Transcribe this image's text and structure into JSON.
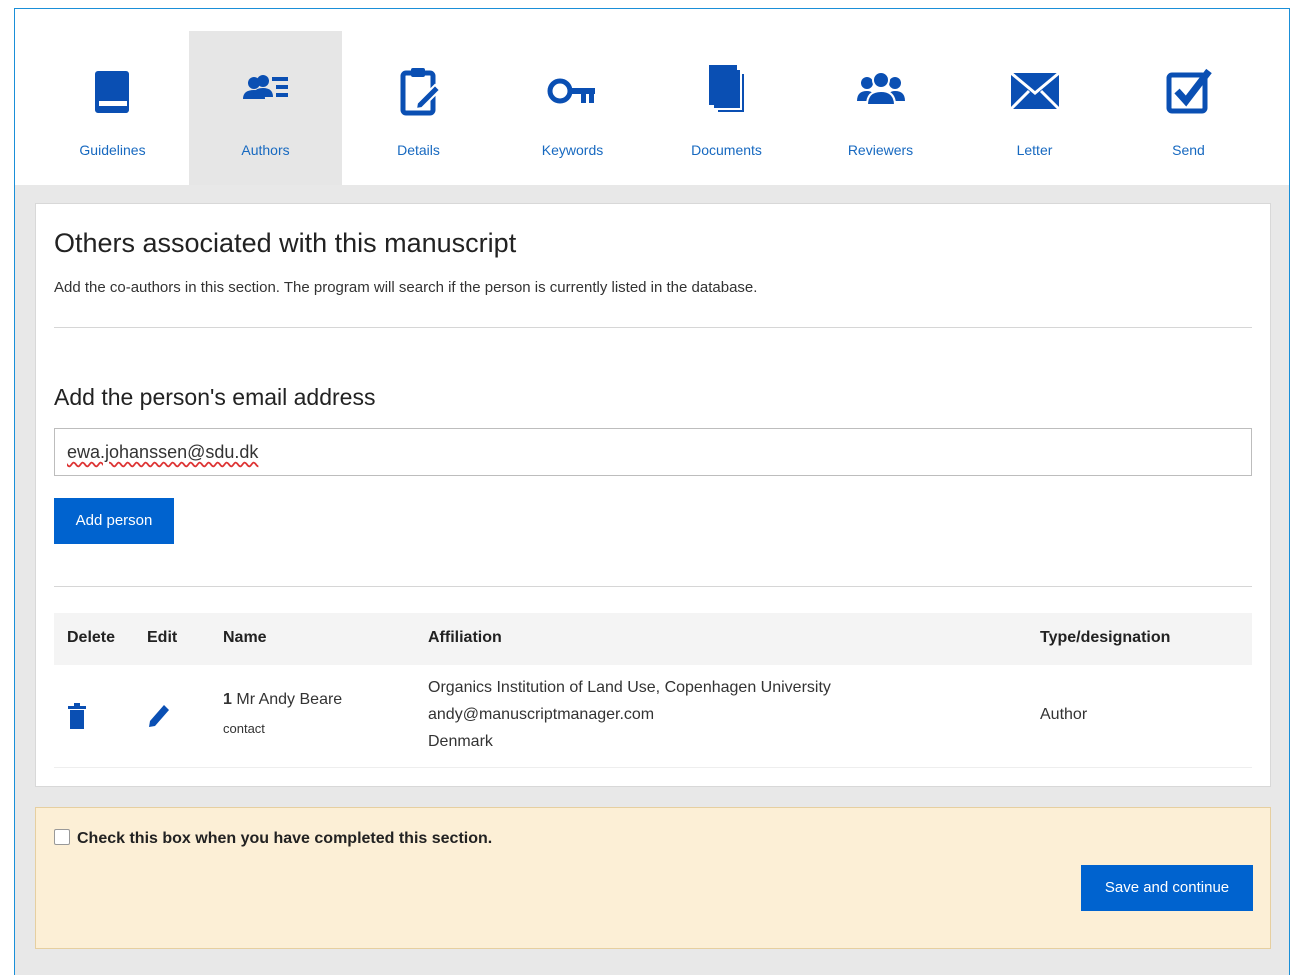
{
  "colors": {
    "accent": "#0063cf",
    "tab_label": "#1769c0",
    "footer_bg": "#fcefd6"
  },
  "tabs": [
    {
      "label": "Guidelines",
      "icon": "book-icon"
    },
    {
      "label": "Authors",
      "icon": "user-list-icon",
      "active": true
    },
    {
      "label": "Details",
      "icon": "clipboard-edit-icon"
    },
    {
      "label": "Keywords",
      "icon": "key-icon"
    },
    {
      "label": "Documents",
      "icon": "documents-icon"
    },
    {
      "label": "Reviewers",
      "icon": "users-icon"
    },
    {
      "label": "Letter",
      "icon": "envelope-icon"
    },
    {
      "label": "Send",
      "icon": "checkbox-icon"
    }
  ],
  "section": {
    "title": "Others associated with this manuscript",
    "description": "Add the co-authors in this section. The program will search if the person is currently listed in the database."
  },
  "email": {
    "label": "Add the person's email address",
    "value": "ewa.johanssen@sdu.dk",
    "add_button": "Add person"
  },
  "table": {
    "headers": {
      "delete": "Delete",
      "edit": "Edit",
      "name": "Name",
      "affiliation": "Affiliation",
      "type": "Type/designation"
    },
    "rows": [
      {
        "index": "1",
        "name": "Mr Andy Beare",
        "role": "contact",
        "affiliation_org": "Organics Institution of Land Use, Copenhagen University",
        "affiliation_email": "andy@manuscriptmanager.com",
        "affiliation_country": "Denmark",
        "type": "Author"
      }
    ]
  },
  "footer": {
    "checkbox_label": "Check this box when you have completed this section.",
    "save_button": "Save and continue"
  }
}
